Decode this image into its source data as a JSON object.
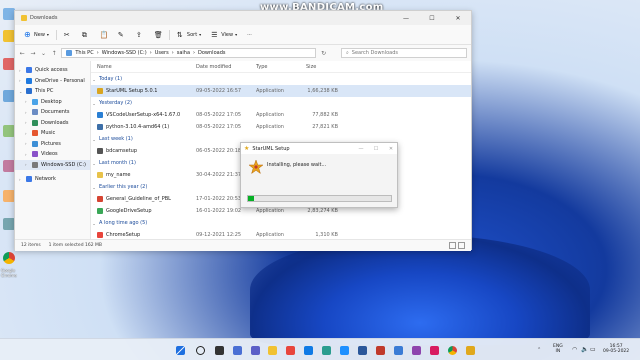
{
  "watermark": "www.BANDICAM.com",
  "desktop": {
    "chrome_label": "Google Chrome"
  },
  "explorer": {
    "window_title": "Downloads",
    "toolbar": {
      "new_label": "New",
      "sort_label": "Sort",
      "view_label": "View",
      "more_label": "···"
    },
    "path_segments": [
      "This PC",
      "Windows-SSD (C:)",
      "Users",
      "saiha",
      "Downloads"
    ],
    "search_placeholder": "Search Downloads",
    "sidebar": [
      {
        "label": "Quick access",
        "icon": "star-icon",
        "color": "#3b78e7"
      },
      {
        "label": "OneDrive - Personal",
        "icon": "cloud-icon",
        "color": "#1f7ae0"
      },
      {
        "label": "This PC",
        "icon": "pc-icon",
        "color": "#2a6fcf"
      },
      {
        "label": "Desktop",
        "icon": "desktop-icon",
        "color": "#4aa3e8"
      },
      {
        "label": "Documents",
        "icon": "documents-icon",
        "color": "#6b8cc4"
      },
      {
        "label": "Downloads",
        "icon": "download-icon",
        "color": "#2f8f5b"
      },
      {
        "label": "Music",
        "icon": "music-icon",
        "color": "#e5572f"
      },
      {
        "label": "Pictures",
        "icon": "pictures-icon",
        "color": "#3d8fd6"
      },
      {
        "label": "Videos",
        "icon": "videos-icon",
        "color": "#8a52c9"
      },
      {
        "label": "Windows-SSD (C:)",
        "icon": "drive-icon",
        "color": "#7a7a7a"
      },
      {
        "label": "Network",
        "icon": "network-icon",
        "color": "#3b78e7"
      }
    ],
    "columns": [
      "Name",
      "Date modified",
      "Type",
      "Size"
    ],
    "groups": [
      {
        "label": "Today (1)",
        "rows": [
          {
            "name": "StarUML Setup 5.0.1",
            "date": "09-05-2022 16:57",
            "type": "Application",
            "size": "1,66,238 KB",
            "icon_color": "#d9a520"
          }
        ]
      },
      {
        "label": "Yesterday (2)",
        "rows": [
          {
            "name": "VSCodeUserSetup-x64-1.67.0",
            "date": "08-05-2022 17:05",
            "type": "Application",
            "size": "77,882 KB",
            "icon_color": "#2a7fd4"
          },
          {
            "name": "python-3.10.4-amd64 (1)",
            "date": "08-05-2022 17:05",
            "type": "Application",
            "size": "27,821 KB",
            "icon_color": "#3d6fa8"
          }
        ]
      },
      {
        "label": "Last week (1)",
        "rows": [
          {
            "name": "bdcamsetup",
            "date": "06-05-2022 20:18",
            "type": "Application",
            "size": "",
            "icon_color": "#555555"
          }
        ]
      },
      {
        "label": "Last month (1)",
        "rows": [
          {
            "name": "my_name",
            "date": "30-04-2022 21:37",
            "type": "",
            "size": "",
            "icon_color": "#e8c24a"
          }
        ]
      },
      {
        "label": "Earlier this year (2)",
        "rows": [
          {
            "name": "General_Guideline_of_PBL",
            "date": "17-01-2022 20:53",
            "type": "",
            "size": "",
            "icon_color": "#d64533"
          },
          {
            "name": "GoogleDriveSetup",
            "date": "16-01-2022 19:02",
            "type": "Application",
            "size": "2,83,274 KB",
            "icon_color": "#3aa757"
          }
        ]
      },
      {
        "label": "A long time ago (5)",
        "rows": [
          {
            "name": "ChromeSetup",
            "date": "09-12-2021 12:25",
            "type": "Application",
            "size": "1,310 KB",
            "icon_color": "#e8453c"
          }
        ]
      }
    ],
    "status": {
      "items": "12 items",
      "selected": "1 item selected 162 MB"
    }
  },
  "setup": {
    "title": "StarUML Setup",
    "message": "Installing, please wait...",
    "progress": 0.04,
    "progress_color": "#06b025"
  },
  "tray": {
    "lang": "ENG",
    "region": "IN",
    "time": "16:57",
    "date": "09-05-2022"
  }
}
